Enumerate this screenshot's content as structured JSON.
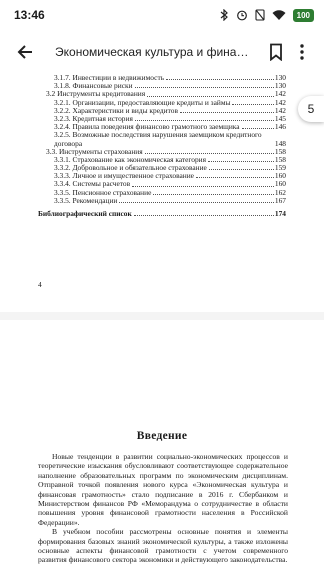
{
  "status": {
    "time": "13:46",
    "battery": "100"
  },
  "app_bar": {
    "title": "Экономическая культура и финансовая грамотность"
  },
  "side_badge": "5",
  "toc": [
    {
      "level": 1,
      "num": "3.1.7.",
      "text": "Инвестиции в недвижимость",
      "page": "130"
    },
    {
      "level": 1,
      "num": "3.1.8.",
      "text": "Финансовые риски",
      "page": "130"
    },
    {
      "level": 0,
      "num": "3.2",
      "text": "Инструменты кредитования",
      "page": "142"
    },
    {
      "level": 1,
      "num": "3.2.1.",
      "text": "Организации, предоставляющие кредиты и займы",
      "page": "142"
    },
    {
      "level": 1,
      "num": "3.2.2.",
      "text": "Характеристики и виды кредитов",
      "page": "142"
    },
    {
      "level": 1,
      "num": "3.2.3.",
      "text": "Кредитная история",
      "page": "145"
    },
    {
      "level": 1,
      "num": "3.2.4.",
      "text": "Правила поведения финансово грамотного заемщика",
      "page": "146"
    },
    {
      "level": 1,
      "num": "3.2.5.",
      "text": "Возможные последствия нарушения заемщиком кредитного договора",
      "page": "148"
    },
    {
      "level": 0,
      "num": "3.3.",
      "text": "Инструменты страхования",
      "page": "158"
    },
    {
      "level": 1,
      "num": "3.3.1.",
      "text": "Страхование как экономическая категория",
      "page": "158"
    },
    {
      "level": 1,
      "num": "3.3.2.",
      "text": "Добровольное и обязательное страхование",
      "page": "159"
    },
    {
      "level": 1,
      "num": "3.3.3.",
      "text": "Личное и имущественное страхование",
      "page": "160"
    },
    {
      "level": 1,
      "num": "3.3.4.",
      "text": "Системы расчетов",
      "page": "160"
    },
    {
      "level": 1,
      "num": "3.3.5.",
      "text": "Пенсионное страхование",
      "page": "162"
    },
    {
      "level": 1,
      "num": "3.3.5.",
      "text": "Рекомендации",
      "page": "167"
    },
    {
      "level": -1,
      "num": "",
      "text": "Библиографический список",
      "page": "174"
    }
  ],
  "page_number": "4",
  "section_heading": "Введение",
  "paragraphs": [
    "Новые тенденции в развитии социально-экономических процессов и теоретические изыскания обусловливают соответствующее содержательное наполнение образовательных программ по экономическим дисциплинам. Отправной точкой появления нового курса «Экономическая культура и финансовая грамотность» стало подписание в 2016 г. Сбербанком и Министерством финансов РФ «Меморандума о сотрудничестве в области повышения уровня финансовой грамотности населения в Российской Федерации».",
    "В учебном пособии рассмотрены основные понятия и элементы формирования базовых знаний экономической культуры, а также изложены основные аспекты финансовой грамотности с учетом современного развития финансового сектора экономики и действующего законодательства."
  ]
}
